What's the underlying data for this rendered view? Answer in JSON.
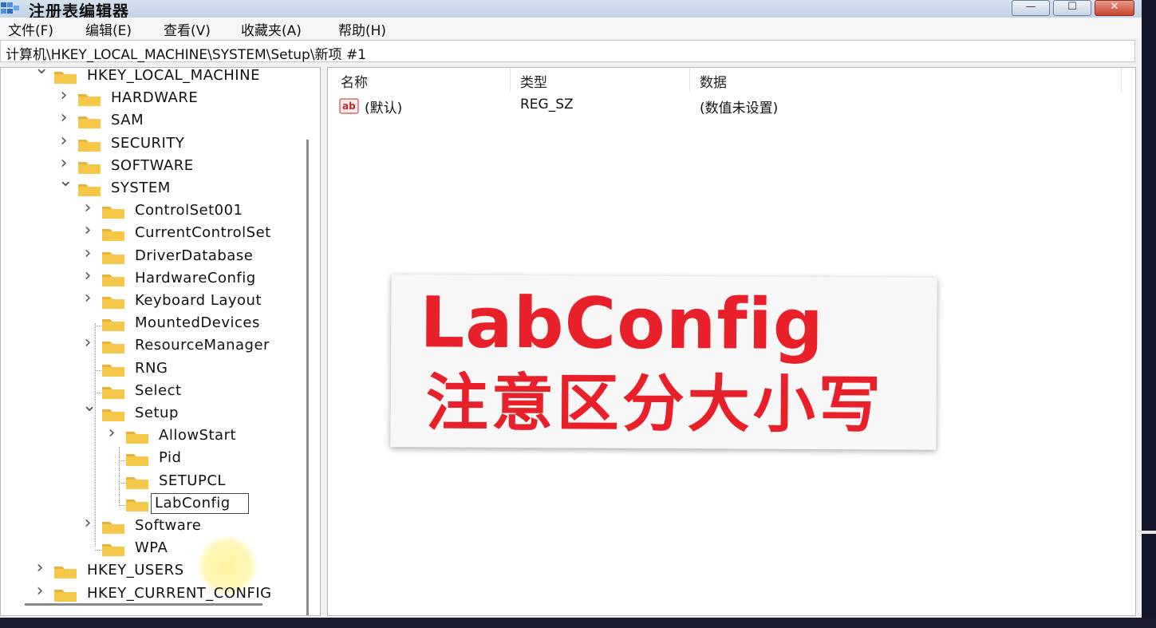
{
  "window": {
    "title": "注册表编辑器",
    "controls": {
      "minimize": "—",
      "maximize": "☐",
      "close": "✕"
    }
  },
  "menu": {
    "items": [
      "文件(F)",
      "编辑(E)",
      "查看(V)",
      "收藏夹(A)",
      "帮助(H)"
    ]
  },
  "address": {
    "path": "计算机\\HKEY_LOCAL_MACHINE\\SYSTEM\\Setup\\新项 #1"
  },
  "tree": {
    "items": [
      {
        "label": "HKEY_LOCAL_MACHINE",
        "expander": "expanded"
      },
      {
        "label": "HARDWARE",
        "expander": "collapsed"
      },
      {
        "label": "SAM",
        "expander": "collapsed"
      },
      {
        "label": "SECURITY",
        "expander": "collapsed"
      },
      {
        "label": "SOFTWARE",
        "expander": "collapsed"
      },
      {
        "label": "SYSTEM",
        "expander": "expanded"
      },
      {
        "label": "ControlSet001",
        "expander": "collapsed"
      },
      {
        "label": "CurrentControlSet",
        "expander": "collapsed"
      },
      {
        "label": "DriverDatabase",
        "expander": "collapsed"
      },
      {
        "label": "HardwareConfig",
        "expander": "collapsed"
      },
      {
        "label": "Keyboard Layout",
        "expander": "collapsed"
      },
      {
        "label": "MountedDevices",
        "expander": "none"
      },
      {
        "label": "ResourceManager",
        "expander": "collapsed"
      },
      {
        "label": "RNG",
        "expander": "none"
      },
      {
        "label": "Select",
        "expander": "none"
      },
      {
        "label": "Setup",
        "expander": "expanded"
      },
      {
        "label": "AllowStart",
        "expander": "collapsed"
      },
      {
        "label": "Pid",
        "expander": "none"
      },
      {
        "label": "SETUPCL",
        "expander": "none"
      },
      {
        "label": "LabConfig",
        "expander": "none",
        "state": "renaming"
      },
      {
        "label": "Software",
        "expander": "collapsed"
      },
      {
        "label": "WPA",
        "expander": "none"
      },
      {
        "label": "HKEY_USERS",
        "expander": "collapsed"
      },
      {
        "label": "HKEY_CURRENT_CONFIG",
        "expander": "collapsed"
      }
    ]
  },
  "values": {
    "headers": {
      "name": "名称",
      "type": "类型",
      "data": "数据"
    },
    "rows": [
      {
        "icon": "ab",
        "name": "(默认)",
        "type": "REG_SZ",
        "data": "(数值未设置)"
      }
    ]
  },
  "overlay": {
    "line1": "LabConfig",
    "line2": "注意区分大小写",
    "text_color": "#e8202a"
  },
  "colors": {
    "folder": "#f5c542",
    "titlebar": "#c9d7ea"
  }
}
